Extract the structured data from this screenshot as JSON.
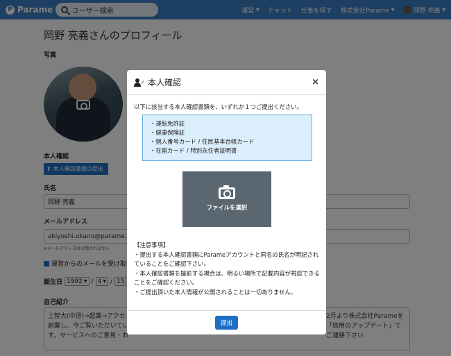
{
  "navbar": {
    "brand": "Parame",
    "search_placeholder": "ユーザー検索",
    "items": [
      {
        "label": "運営",
        "dropdown": true
      },
      {
        "label": "チャット",
        "dropdown": false
      },
      {
        "label": "仕事を探す",
        "dropdown": false
      },
      {
        "label": "株式会社Parame",
        "dropdown": true
      },
      {
        "label": "岡野 亮義",
        "dropdown": true
      }
    ]
  },
  "profile": {
    "title": "岡野 亮義さんのプロフィール",
    "photo_label": "写真",
    "identity_label": "本人確認",
    "identity_button": "本人確認書類の提出",
    "name_label": "氏名",
    "name_value": "岡野 亮義",
    "email_label": "メールアドレス",
    "email_value": "akiyoshi.okano@parame.jp",
    "email_note": "※メールアドレスは公開されません",
    "mail_opt": "運営からのメールを受け取",
    "birth_label": "誕生日",
    "birth_year": "1992",
    "birth_month": "4",
    "birth_day": "15",
    "bio_label": "自己紹介",
    "bio_left": [
      "上智大(中退)→起業→アクセ",
      "創業し、今ご覧いただいてい",
      "す。サービスへのご意見・お"
    ],
    "bio_right": [
      "2月より株式会社Parameを",
      "「信用のアップデート」で",
      "ご連絡下さい"
    ]
  },
  "modal": {
    "title": "本人確認",
    "close": "×",
    "intro": "以下に該当する本人確認書類を、いずれか１つご提出ください。",
    "documents": [
      "・運転免許証",
      "・健康保険証",
      "・個人番号カード / 住民基本台帳カード",
      "・在留カード / 特別永住者証明書"
    ],
    "file_button": "ファイルを選択",
    "notes_title": "【注意事項】",
    "notes": [
      "・提出する本人確認書類にParameアカウントと同名の氏名が明記されていることをご確認下さい。",
      "・本人確認書類を撮影する場合は、明るい場所で記載内容が視認できることをご確認ください。",
      "・ご提出頂いた本人情報が公開されることは一切ありません。"
    ],
    "submit": "提出"
  },
  "colors": {
    "navbar": "#3b7fc4",
    "primary": "#1e6fc4",
    "info_bg": "#dbeefb",
    "info_border": "#6aaee0",
    "file_btn": "#5a6670"
  }
}
